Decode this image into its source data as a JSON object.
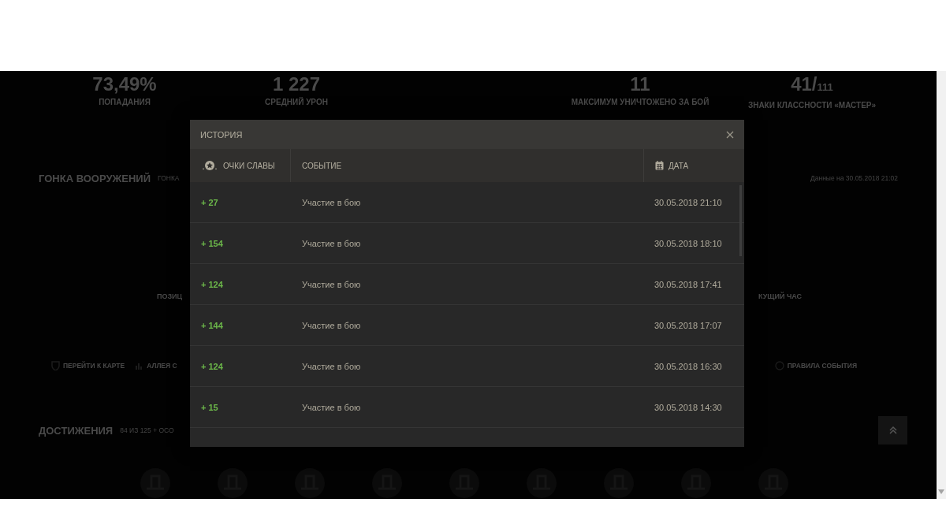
{
  "background": {
    "stats": [
      {
        "value": "73,49%",
        "label": "ПОПАДАНИЯ"
      },
      {
        "value": "1 227",
        "label": "СРЕДНИЙ УРОН"
      },
      {
        "value": "11",
        "label": "МАКСИМУМ УНИЧТОЖЕНО ЗА БОЙ"
      },
      {
        "value": "41/",
        "suffix": "111",
        "label": "ЗНАКИ КЛАССНОСТИ «МАСТЕР»"
      }
    ],
    "arms_race": {
      "title": "ГОНКА ВООРУЖЕНИЙ",
      "subtitle": "ГОНКА",
      "updated": "Данные на 30.05.2018 21:02",
      "position_label": "ПОЗИЦ",
      "hour_label": "КУЩИЙ ЧАС",
      "links_left": [
        {
          "kind": "map",
          "label": "ПЕРЕЙТИ К КАРТЕ"
        },
        {
          "kind": "chart",
          "label": "АЛЛЕЯ С"
        }
      ],
      "links_right": [
        {
          "kind": "help",
          "label": "ПРАВИЛА СОБЫТИЯ"
        }
      ]
    },
    "achievements": {
      "title": "ДОСТИЖЕНИЯ",
      "count": "84 ИЗ 125 + ОСО"
    }
  },
  "dialog": {
    "title": "ИСТОРИЯ",
    "columns": [
      {
        "kind": "points",
        "label": "ОЧКИ СЛАВЫ"
      },
      {
        "kind": "event",
        "label": "СОБЫТИЕ"
      },
      {
        "kind": "date",
        "label": "ДАТА"
      }
    ],
    "rows": [
      {
        "points": "+ 27",
        "event": "Участие в бою",
        "date": "30.05.2018 21:10"
      },
      {
        "points": "+ 154",
        "event": "Участие в бою",
        "date": "30.05.2018 18:10"
      },
      {
        "points": "+ 124",
        "event": "Участие в бою",
        "date": "30.05.2018 17:41"
      },
      {
        "points": "+ 144",
        "event": "Участие в бою",
        "date": "30.05.2018 17:07"
      },
      {
        "points": "+ 124",
        "event": "Участие в бою",
        "date": "30.05.2018 16:30"
      },
      {
        "points": "+ 15",
        "event": "Участие в бою",
        "date": "30.05.2018 14:30"
      }
    ]
  }
}
